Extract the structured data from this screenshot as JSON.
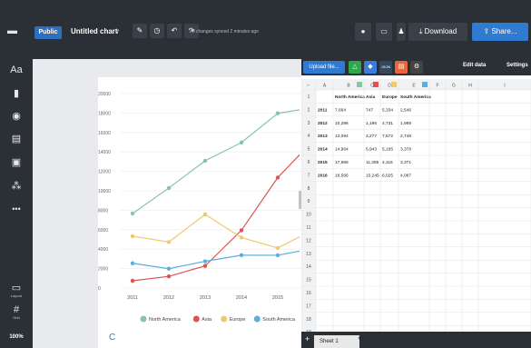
{
  "topbar": {
    "visibility": "Public",
    "title": "Untitled chart",
    "title_caret": "∨",
    "saved_status": "All changes synced 2 minutes ago",
    "download_label": "Download",
    "share_label": "Share...",
    "download_icon": "download-icon",
    "share_icon": "share-icon"
  },
  "sidebar": {
    "items": [
      {
        "icon": "Aa",
        "name": "text-style"
      },
      {
        "icon": "▮",
        "name": "chart-type"
      },
      {
        "icon": "◉",
        "name": "palette"
      },
      {
        "icon": "▤",
        "name": "data"
      },
      {
        "icon": "▣",
        "name": "image"
      },
      {
        "icon": "⁂",
        "name": "decorate"
      },
      {
        "icon": "•••",
        "name": "more"
      }
    ],
    "layout_label": "Layout",
    "grid_label": "Grid",
    "zoom": "100%"
  },
  "panel": {
    "upload_label": "Upload file...",
    "tabs": [
      "Edit data",
      "Settings"
    ],
    "col_headers": [
      "A",
      "B",
      "C",
      "D",
      "E",
      "F",
      "G",
      "H",
      "I"
    ],
    "header_row": [
      "",
      "North America",
      "Asia",
      "Europe",
      "South America"
    ],
    "rows": [
      [
        "2011",
        "7,664",
        "747",
        "5,334",
        "2,546"
      ],
      [
        "2012",
        "10,286",
        "1,195",
        "4,731",
        "1,989"
      ],
      [
        "2013",
        "13,094",
        "2,277",
        "7,572",
        "2,748"
      ],
      [
        "2014",
        "14,964",
        "5,943",
        "5,195",
        "3,378"
      ],
      [
        "2015",
        "17,968",
        "11,365",
        "4,116",
        "3,371"
      ],
      [
        "2016",
        "18,566",
        "15,245",
        "6,025",
        "4,087"
      ]
    ],
    "row_count": 19,
    "sheet_name": "Sheet 1",
    "sheet_caret": "∨"
  },
  "chart_data": {
    "type": "line",
    "categories": [
      "2011",
      "2012",
      "2013",
      "2014",
      "2015",
      "2016"
    ],
    "ylim": [
      0,
      20000
    ],
    "yticks": [
      "20000",
      "18000",
      "16000",
      "14000",
      "12000",
      "10000",
      "8000",
      "6000",
      "4000",
      "2000",
      "0"
    ],
    "series": [
      {
        "name": "North America",
        "color": "#86c6a4",
        "values": [
          7664,
          10286,
          13094,
          14964,
          17968,
          18566
        ]
      },
      {
        "name": "Asia",
        "color": "#e05252",
        "values": [
          747,
          1195,
          2277,
          5943,
          11365,
          15245
        ]
      },
      {
        "name": "Europe",
        "color": "#f0c96d",
        "values": [
          5334,
          4731,
          7572,
          5195,
          4116,
          6025
        ]
      },
      {
        "name": "South America",
        "color": "#5aaee0",
        "values": [
          2546,
          1989,
          2748,
          3378,
          3371,
          4087
        ]
      }
    ],
    "legend_placement": "bottom"
  }
}
